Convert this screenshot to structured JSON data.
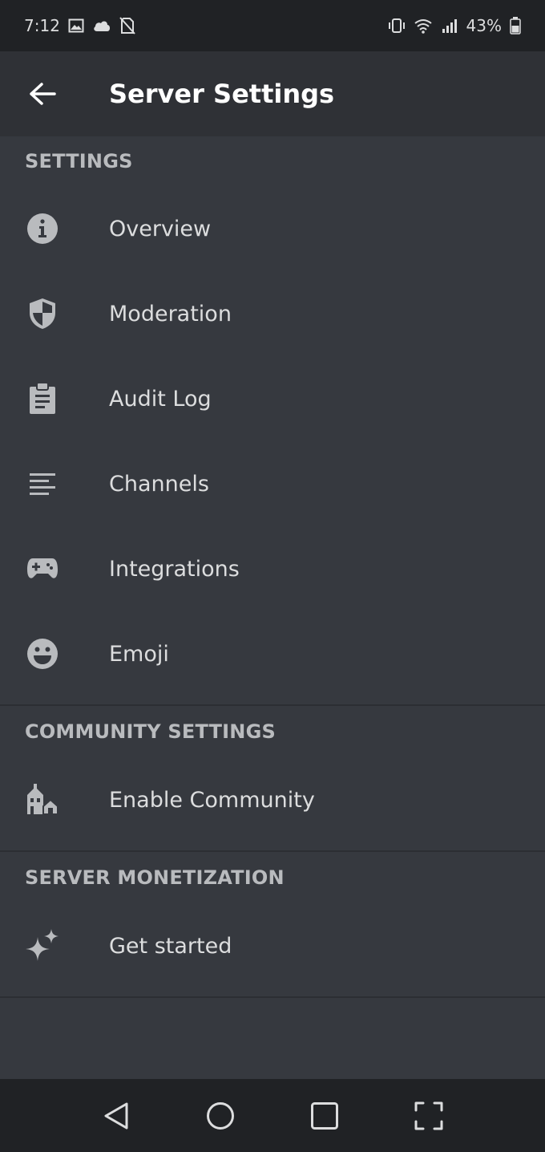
{
  "status_bar": {
    "time": "7:12",
    "battery": "43%",
    "icons_left": [
      "gallery-icon",
      "cloud-icon",
      "no-sim-icon"
    ],
    "icons_right": [
      "vibrate-icon",
      "wifi-icon",
      "signal-icon",
      "battery-icon"
    ]
  },
  "app_bar": {
    "title": "Server Settings",
    "back_icon": "arrow-left-icon"
  },
  "sections": [
    {
      "header": "SETTINGS",
      "items": [
        {
          "label": "Overview",
          "icon": "info-icon"
        },
        {
          "label": "Moderation",
          "icon": "shield-icon"
        },
        {
          "label": "Audit Log",
          "icon": "clipboard-icon"
        },
        {
          "label": "Channels",
          "icon": "list-icon"
        },
        {
          "label": "Integrations",
          "icon": "gamepad-icon"
        },
        {
          "label": "Emoji",
          "icon": "smiley-icon"
        }
      ]
    },
    {
      "header": "COMMUNITY SETTINGS",
      "items": [
        {
          "label": "Enable Community",
          "icon": "community-icon"
        }
      ]
    },
    {
      "header": "SERVER MONETIZATION",
      "items": [
        {
          "label": "Get started",
          "icon": "sparkle-icon"
        }
      ]
    }
  ],
  "colors": {
    "background": "#36393f",
    "app_bar": "#2f3136",
    "status_bar": "#202225",
    "header_text": "#b9bbbe",
    "item_text": "#dcddde",
    "icon": "#b9bbbe"
  },
  "nav_bar": {
    "buttons": [
      "back-triangle-icon",
      "home-circle-icon",
      "recents-square-icon",
      "screenshot-frame-icon"
    ]
  }
}
